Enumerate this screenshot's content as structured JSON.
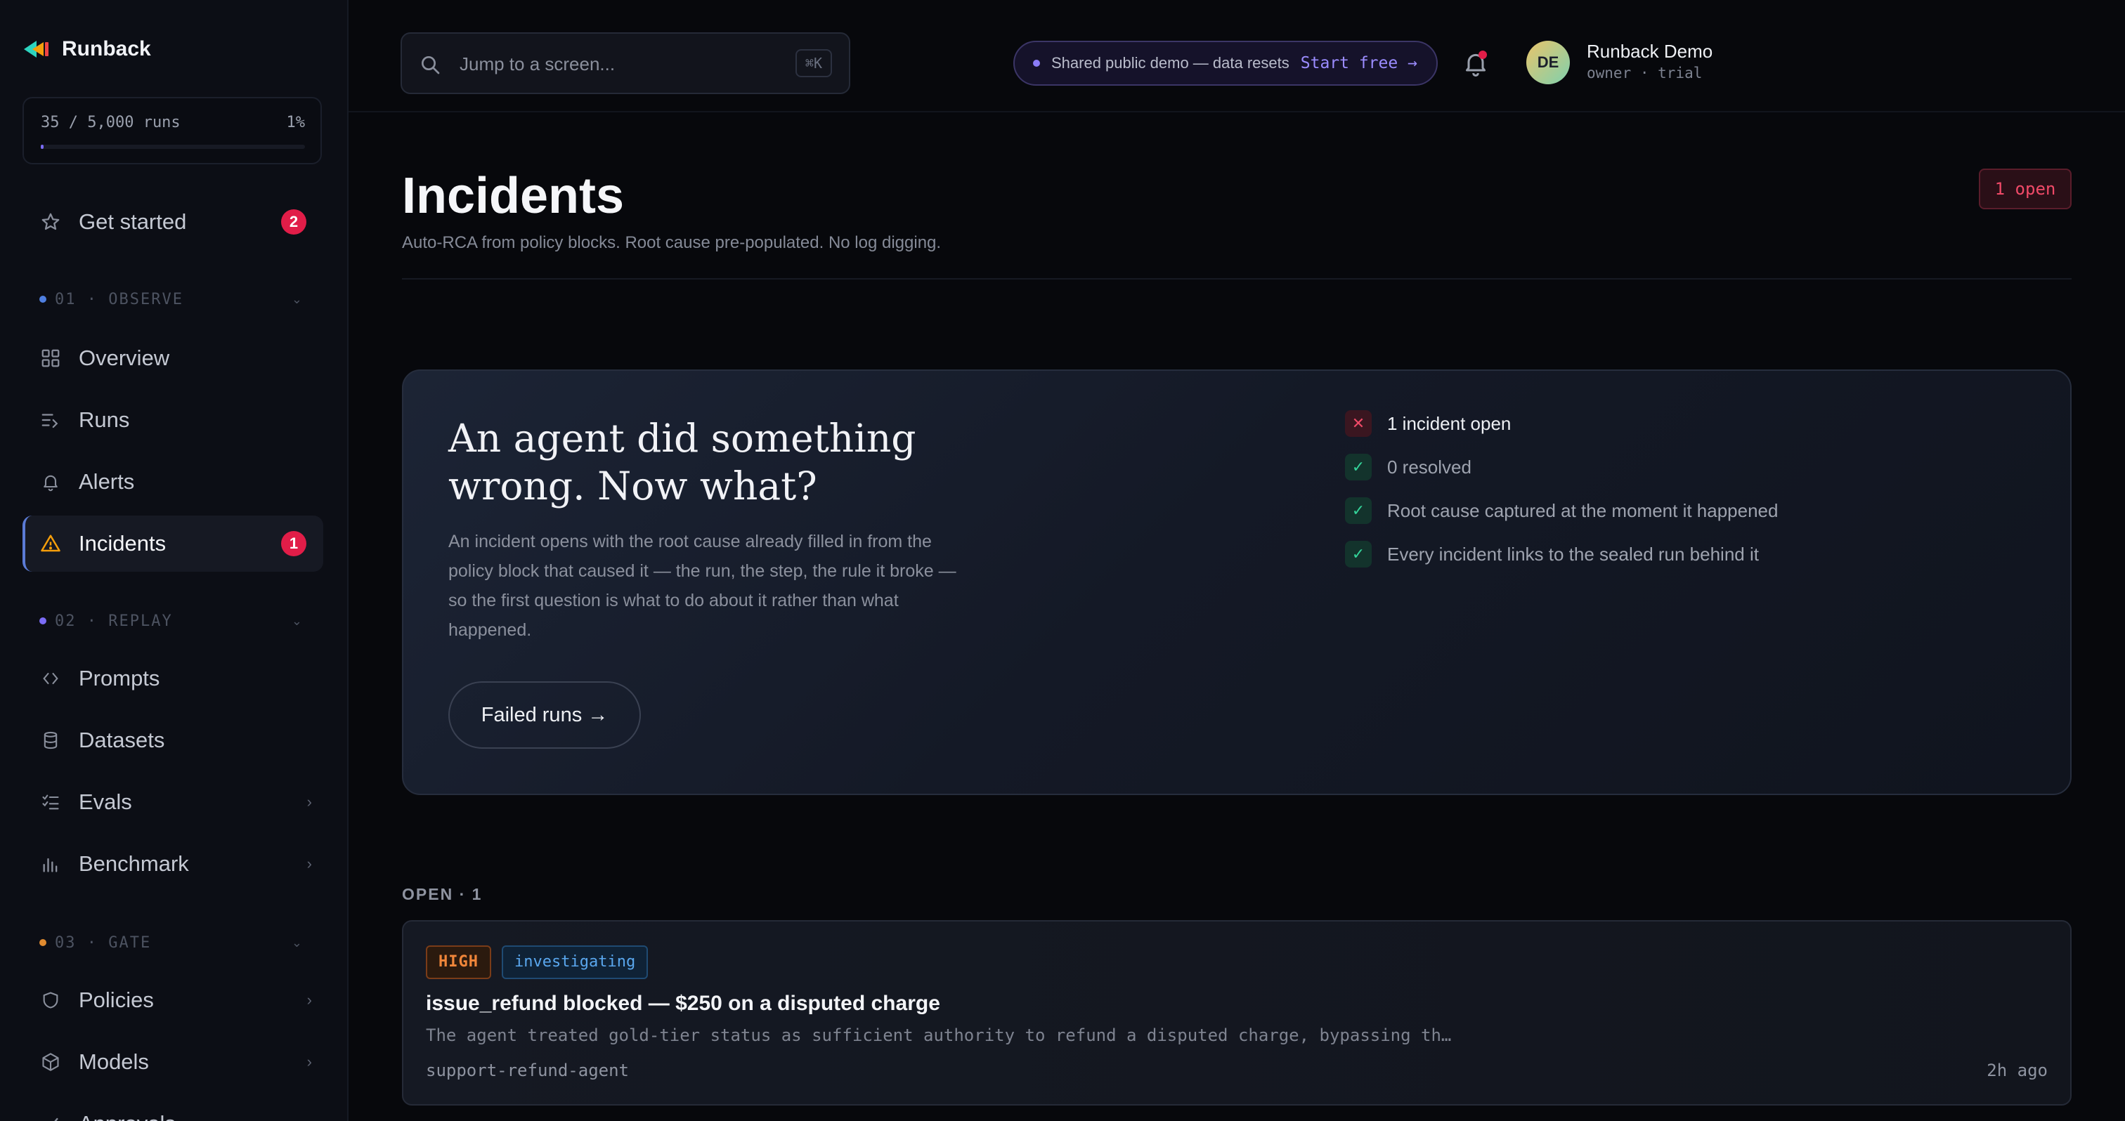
{
  "brand": {
    "name": "Runback"
  },
  "usage": {
    "label": "35 / 5,000 runs",
    "percent_label": "1%",
    "fraction": 0.007
  },
  "sidebar": {
    "get_started": {
      "label": "Get started",
      "badge": "2",
      "icon": "star-icon"
    },
    "sections": [
      {
        "label": "01 · OBSERVE",
        "color": "#4f7fe0"
      },
      {
        "label": "02 · REPLAY",
        "color": "#7b6cf6"
      },
      {
        "label": "03 · GATE",
        "color": "#e08a2f"
      }
    ],
    "items": [
      {
        "label": "Overview",
        "icon": "grid-icon"
      },
      {
        "label": "Runs",
        "icon": "list-arrow-icon"
      },
      {
        "label": "Alerts",
        "icon": "bell-icon"
      },
      {
        "label": "Incidents",
        "icon": "warning-icon",
        "badge": "1",
        "active": true
      },
      {
        "label": "Prompts",
        "icon": "code-brackets-icon"
      },
      {
        "label": "Datasets",
        "icon": "database-icon"
      },
      {
        "label": "Evals",
        "icon": "checklist-icon"
      },
      {
        "label": "Benchmark",
        "icon": "bar-chart-icon"
      },
      {
        "label": "Policies",
        "icon": "shield-icon"
      },
      {
        "label": "Models",
        "icon": "cube-icon"
      },
      {
        "label": "Approvals",
        "icon": "check-icon"
      }
    ]
  },
  "topbar": {
    "search_placeholder": "Jump to a screen...",
    "search_shortcut": "⌘K",
    "demo_text": "Shared public demo — data resets",
    "demo_link": "Start free →",
    "user_initials": "DE",
    "user_name": "Runback Demo",
    "user_role": "owner · trial"
  },
  "page": {
    "title": "Incidents",
    "subtitle": "Auto-RCA from policy blocks. Root cause pre-populated. No log digging.",
    "open_badge": "1 open"
  },
  "hero": {
    "title": "An agent did something wrong. Now what?",
    "body": "An incident opens with the root cause already filled in from the policy block that caused it — the run, the step, the rule it broke — so the first question is what to do about it rather than what happened.",
    "button": "Failed runs →",
    "checklist": [
      {
        "text": "1 incident open",
        "status": "x",
        "strong": true
      },
      {
        "text": "0 resolved",
        "status": "check",
        "strong": false
      },
      {
        "text": "Root cause captured at the moment it happened",
        "status": "check",
        "strong": false
      },
      {
        "text": "Every incident links to the sealed run behind it",
        "status": "check",
        "strong": false
      }
    ]
  },
  "open_list": {
    "label": "OPEN · 1",
    "incidents": [
      {
        "severity": "HIGH",
        "status": "investigating",
        "title": "issue_refund blocked — $250 on a disputed charge",
        "description": "The agent treated gold-tier status as sufficient authority to refund a disputed charge, bypassing th…",
        "agent": "support-refund-agent",
        "time": "2h ago"
      }
    ]
  }
}
